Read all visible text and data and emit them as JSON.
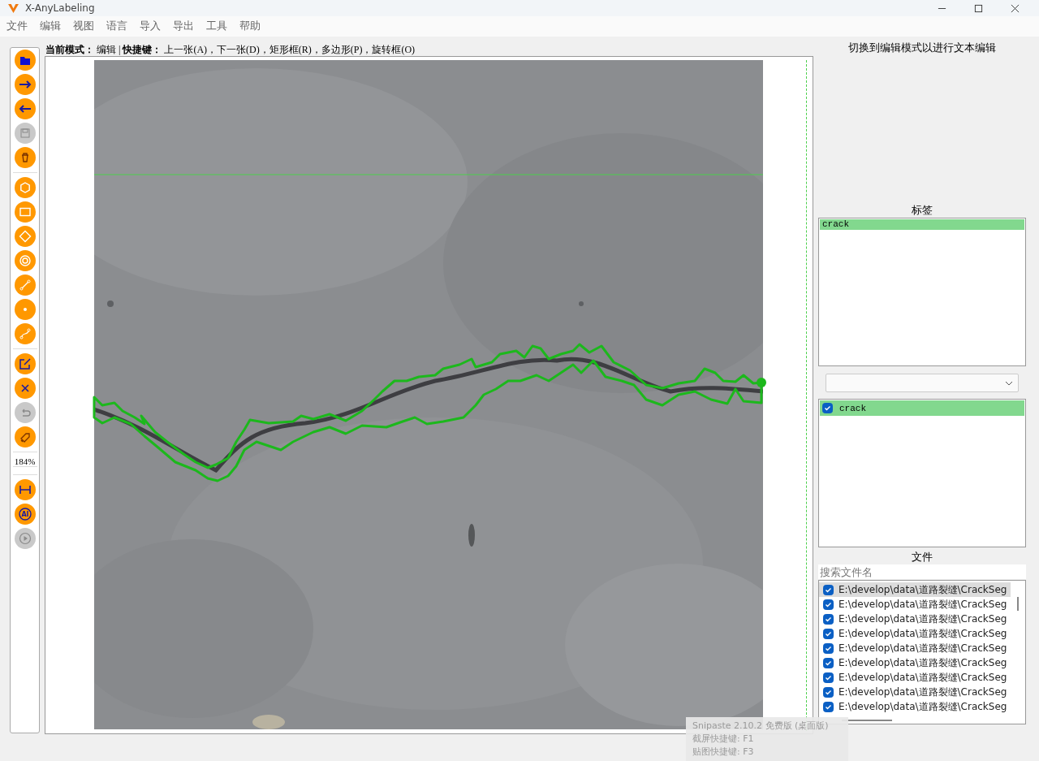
{
  "window": {
    "title": "X-AnyLabeling"
  },
  "menu": [
    "文件",
    "编辑",
    "视图",
    "语言",
    "导入",
    "导出",
    "工具",
    "帮助"
  ],
  "toolbar": {
    "sections": [
      {
        "kind": "tools",
        "items": [
          {
            "disabled": false
          },
          {
            "disabled": false
          },
          {
            "disabled": false
          },
          {
            "disabled": true
          },
          {
            "disabled": false
          }
        ]
      },
      {
        "kind": "tools",
        "items": [
          {
            "disabled": false
          },
          {
            "disabled": false
          },
          {
            "disabled": false
          },
          {
            "disabled": false
          },
          {
            "disabled": false
          },
          {
            "disabled": false
          },
          {
            "disabled": false
          }
        ]
      },
      {
        "kind": "tools",
        "items": [
          {
            "disabled": false
          },
          {
            "disabled": false
          },
          {
            "disabled": true
          },
          {
            "disabled": false
          }
        ]
      },
      {
        "kind": "zoom",
        "text": "184%"
      },
      {
        "kind": "tools",
        "items": [
          {
            "disabled": false
          },
          {
            "disabled": false,
            "text": "AI"
          },
          {
            "disabled": true
          }
        ]
      }
    ]
  },
  "mode_line": "**当前模式：** 编辑 | **快捷键：** 上一张(A)，下一张(D)，矩形框(R)，多边形(P)，旋转框(O)",
  "edit_panel": {
    "hint": "切换到编辑模式以进行文本编辑"
  },
  "labels": {
    "title": "标签",
    "items": [
      {
        "text": "crack",
        "selected": true
      }
    ]
  },
  "shapes": {
    "items": [
      {
        "text": "crack",
        "checked": true,
        "selected": true
      }
    ]
  },
  "files": {
    "title": "文件",
    "search": {
      "placeholder": "搜索文件名"
    },
    "items": [
      {
        "path": "E:\\develop\\data\\道路裂缝\\CrackSeg",
        "checked": true,
        "selected": true
      },
      {
        "path": "E:\\develop\\data\\道路裂缝\\CrackSeg",
        "checked": true,
        "selected": false
      },
      {
        "path": "E:\\develop\\data\\道路裂缝\\CrackSeg",
        "checked": true,
        "selected": false
      },
      {
        "path": "E:\\develop\\data\\道路裂缝\\CrackSeg",
        "checked": true,
        "selected": false
      },
      {
        "path": "E:\\develop\\data\\道路裂缝\\CrackSeg",
        "checked": true,
        "selected": false
      },
      {
        "path": "E:\\develop\\data\\道路裂缝\\CrackSeg",
        "checked": true,
        "selected": false
      },
      {
        "path": "E:\\develop\\data\\道路裂缝\\CrackSeg",
        "checked": true,
        "selected": false
      },
      {
        "path": "E:\\develop\\data\\道路裂缝\\CrackSeg",
        "checked": true,
        "selected": false
      },
      {
        "path": "E:\\develop\\data\\道路裂缝\\CrackSeg",
        "checked": true,
        "selected": false
      }
    ]
  },
  "overlay": {
    "title": "Snipaste 2.10.2 免费版 (桌面版)",
    "lines": [
      "截屏快捷键: F1",
      "贴图快捷键: F3"
    ]
  }
}
